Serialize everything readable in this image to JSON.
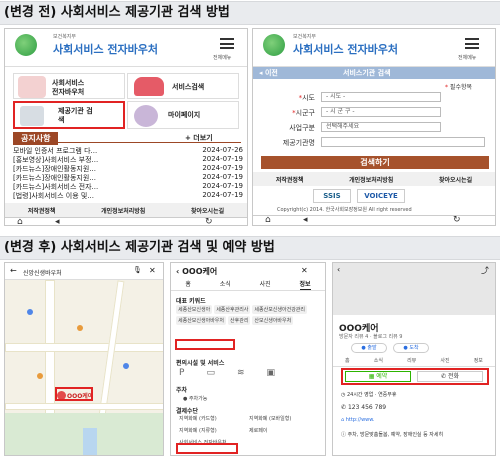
{
  "before": {
    "heading": "(변경 전) 사회서비스 제공기관 검색 방법",
    "left": {
      "logo_sub": "보건복지부",
      "logo_main": "사회서비스 전자바우처",
      "menu_label": "전체메뉴",
      "tiles": {
        "voucher_info": "사회서비스\n전자바우처",
        "service_search": "서비스검색",
        "provider_search": "제공기관 검\n색",
        "mypage": "마이페이지"
      },
      "notice_title": "공지사항",
      "more": "+ 더보기",
      "notices": [
        {
          "title": "모바일 인증서 프로그램 다...",
          "date": "2024-07-26"
        },
        {
          "title": "[홍보영상]사회서비스 부정...",
          "date": "2024-07-19"
        },
        {
          "title": "[카드뉴스]장애인활동지원...",
          "date": "2024-07-19"
        },
        {
          "title": "[카드뉴스]장애인활동지원...",
          "date": "2024-07-19"
        },
        {
          "title": "[카드뉴스]사회서비스 전자...",
          "date": "2024-07-19"
        },
        {
          "title": "[법령]사회서비스 이용 및...",
          "date": "2024-07-19"
        }
      ],
      "footer_nav": [
        "저작권정책",
        "개인정보처리방침",
        "찾아오시는길"
      ]
    },
    "right": {
      "logo_sub": "보건복지부",
      "logo_main": "사회서비스 전자바우처",
      "menu_label": "전체메뉴",
      "back": "이전",
      "page_title": "서비스기관 검색",
      "required": "필수항목",
      "fields": [
        {
          "label": "시도",
          "value": "- 시도 -",
          "required": true
        },
        {
          "label": "시군구",
          "value": "- 시 군 구 -",
          "required": true
        },
        {
          "label": "사업구분",
          "value": "선택해주세요",
          "required": false
        },
        {
          "label": "제공기관명",
          "value": "",
          "required": false
        }
      ],
      "search_button": "검색하기",
      "footer_nav": [
        "저작권정책",
        "개인정보처리방침",
        "찾아오시는길"
      ],
      "ssis_badge": "SSIS",
      "voice_badge": "VOICEYE",
      "copyright": "Copyright(c) 2014. 한국사회보장정보원 All right reserved"
    }
  },
  "after": {
    "heading": "(변경 후) 사회서비스 제공기관 검색 및 예약 방법",
    "map": {
      "search_text": "신앙신생바우처",
      "place_label": "OOO케어"
    },
    "detail": {
      "title": "OOO케어",
      "tabs": [
        "홈",
        "소식",
        "사진",
        "정보"
      ],
      "active_tab": "정보",
      "section_keywords": "대표 키워드",
      "keywords": [
        "세종산모신생아",
        "세종산후관리사",
        "세종산모신생아건강관리",
        "세종산모신생아바우처",
        "산후관리",
        "산모신생아바우처"
      ],
      "section_convenience": "편의시설 및 서비스",
      "section_parking": "주차",
      "parking_value": "주차가능",
      "section_payment": "결제수단",
      "payments": [
        "지역화폐 (카드형)",
        "지역화폐 (모바일형)",
        "지역화폐 (지류형)",
        "제로페이",
        "사회서비스 전자바우처"
      ]
    },
    "place": {
      "title": "OOO케어",
      "subtitle": "방문자 리뷰 4 · 블로그 리뷰 9",
      "actions": [
        "출발",
        "도착"
      ],
      "tabs": [
        "홈",
        "소식",
        "리뷰",
        "사진",
        "정보"
      ],
      "reserve": "예약",
      "call": "전화",
      "hours": "24시간 영업 · 연중무휴",
      "phone": "123 456 789",
      "homepage": "http://www.",
      "info": "주차, 방문맞춤돌봄, 예약, 장애인실 등 자세히"
    }
  }
}
